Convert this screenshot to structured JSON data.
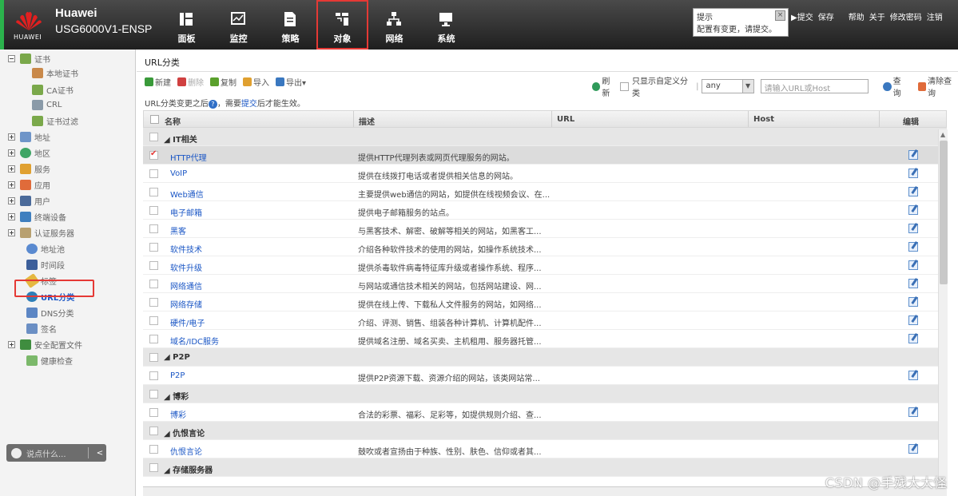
{
  "brand": {
    "logo_text": "HUAWEI",
    "name": "Huawei",
    "model": "USG6000V1-ENSP"
  },
  "nav": [
    {
      "label": "面板",
      "icon": "dashboard-icon"
    },
    {
      "label": "监控",
      "icon": "monitor-icon"
    },
    {
      "label": "策略",
      "icon": "policy-icon"
    },
    {
      "label": "对象",
      "icon": "object-icon",
      "active": true
    },
    {
      "label": "网络",
      "icon": "network-icon"
    },
    {
      "label": "系统",
      "icon": "system-icon"
    }
  ],
  "tip": {
    "title": "提示",
    "message": "配置有变更，请提交。"
  },
  "top_links": [
    "▶提交",
    "保存",
    "帮助",
    "关于",
    "修改密码",
    "注销"
  ],
  "sidebar": {
    "items": [
      {
        "label": "证书",
        "toggle": "minus"
      },
      {
        "label": "本地证书"
      },
      {
        "label": "CA证书"
      },
      {
        "label": "CRL"
      },
      {
        "label": "证书过滤"
      },
      {
        "label": "地址",
        "toggle": "plus"
      },
      {
        "label": "地区",
        "toggle": "plus"
      },
      {
        "label": "服务",
        "toggle": "plus"
      },
      {
        "label": "应用",
        "toggle": "plus"
      },
      {
        "label": "用户",
        "toggle": "plus"
      },
      {
        "label": "终端设备",
        "toggle": "plus"
      },
      {
        "label": "认证服务器",
        "toggle": "plus"
      },
      {
        "label": "地址池"
      },
      {
        "label": "时间段"
      },
      {
        "label": "标签"
      },
      {
        "label": "URL分类",
        "current": true
      },
      {
        "label": "DNS分类"
      },
      {
        "label": "签名"
      },
      {
        "label": "安全配置文件",
        "toggle": "plus"
      },
      {
        "label": "健康检查"
      }
    ],
    "chat_placeholder": "说点什么...",
    "chat_collapse": "<"
  },
  "main": {
    "title": "URL分类",
    "toolbar": {
      "new": "新建",
      "delete": "删除",
      "copy": "复制",
      "import": "导入",
      "export": "导出▾"
    },
    "right": {
      "refresh": "刷新",
      "only_custom": "只显示自定义分类",
      "select_value": "any",
      "search_placeholder": "请输入URL或Host",
      "query": "查询",
      "clear": "清除查询"
    },
    "notice": {
      "prefix": "URL分类变更之后",
      "help": "?",
      "mid": "，需要",
      "link": "提交",
      "suffix": "后才能生效。"
    },
    "columns": {
      "name": "名称",
      "desc": "描述",
      "url": "URL",
      "host": "Host",
      "edit": "编辑"
    }
  },
  "rows": [
    {
      "type": "group",
      "name": "IT相关"
    },
    {
      "type": "item",
      "name": "HTTP代理",
      "desc": "提供HTTP代理列表或网页代理服务的网站。",
      "checked": true
    },
    {
      "type": "item",
      "name": "VoIP",
      "desc": "提供在线拨打电话或者提供相关信息的网站。"
    },
    {
      "type": "item",
      "name": "Web通信",
      "desc": "主要提供web通信的网站，如提供在线视频会议、在..."
    },
    {
      "type": "item",
      "name": "电子邮箱",
      "desc": "提供电子邮箱服务的站点。"
    },
    {
      "type": "item",
      "name": "黑客",
      "desc": "与黑客技术、解密、破解等相关的网站，如黑客工..."
    },
    {
      "type": "item",
      "name": "软件技术",
      "desc": "介绍各种软件技术的使用的网站，如操作系统技术..."
    },
    {
      "type": "item",
      "name": "软件升级",
      "desc": "提供杀毒软件病毒特征库升级或者操作系统、程序..."
    },
    {
      "type": "item",
      "name": "网络通信",
      "desc": "与网站或通信技术相关的网站，包括网站建设、网..."
    },
    {
      "type": "item",
      "name": "网络存储",
      "desc": "提供在线上传、下载私人文件服务的网站，如网络..."
    },
    {
      "type": "item",
      "name": "硬件/电子",
      "desc": "介绍、评测、销售、组装各种计算机、计算机配件..."
    },
    {
      "type": "item",
      "name": "域名/IDC服务",
      "desc": "提供域名注册、域名买卖、主机租用、服务器托管..."
    },
    {
      "type": "group",
      "name": "P2P"
    },
    {
      "type": "item",
      "name": "P2P",
      "desc": "提供P2P资源下载、资源介绍的网站，该类网站常..."
    },
    {
      "type": "group",
      "name": "博彩"
    },
    {
      "type": "item",
      "name": "博彩",
      "desc": "合法的彩票、福彩、足彩等，如提供规则介绍、查..."
    },
    {
      "type": "group",
      "name": "仇恨言论"
    },
    {
      "type": "item",
      "name": "仇恨言论",
      "desc": "鼓吹或者宣扬由于种族、性别、肤色、信仰或者其..."
    },
    {
      "type": "group",
      "name": "存储服务器"
    }
  ],
  "watermark": "CSDN @手残大大怪",
  "colors": {
    "accent_red": "#e53935",
    "link_blue": "#1a56c5",
    "brand_green": "#2bb24c"
  }
}
